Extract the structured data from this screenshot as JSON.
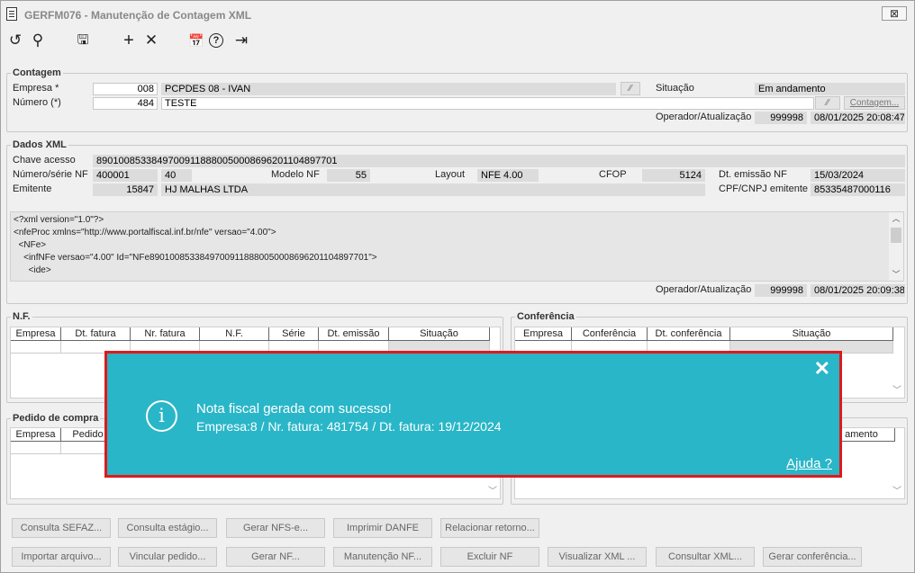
{
  "window": {
    "title": "GERFM076 - Manutenção de Contagem XML",
    "close": "⊠"
  },
  "toolbar": {
    "undo": "↺",
    "search": "⚲",
    "save": "🖫",
    "add": "+",
    "delete": "✕",
    "calendar": "📅",
    "help": "?",
    "exit": "⇥"
  },
  "contagem": {
    "legend": "Contagem",
    "empresa_label": "Empresa *",
    "empresa_code": "008",
    "empresa_name": "PCPDES 08 - IVAN",
    "numero_label": "Número (*)",
    "numero_value": "484",
    "numero_desc": "TESTE",
    "situacao_label": "Situação",
    "situacao_value": "Em andamento",
    "contagem_btn": "Contagem...",
    "operador_label": "Operador/Atualização",
    "operador_value": "999998",
    "operador_date": "08/01/2025 20:08:47"
  },
  "dados_xml": {
    "legend": "Dados XML",
    "chave_label": "Chave acesso",
    "chave_value": "89010085338497009118880050008696201104897701",
    "numero_serie_label": "Número/série NF",
    "numero_value": "400001",
    "serie_value": "40",
    "modelo_label": "Modelo NF",
    "modelo_value": "55",
    "layout_label": "Layout",
    "layout_value": "NFE 4.00",
    "cfop_label": "CFOP",
    "cfop_value": "5124",
    "dt_emissao_label": "Dt. emissão NF",
    "dt_emissao_value": "15/03/2024",
    "emitente_label": "Emitente",
    "emitente_code": "15847",
    "emitente_name": "HJ MALHAS LTDA",
    "cpf_label": "CPF/CNPJ emitente",
    "cpf_value": "85335487000116",
    "xml_lines": [
      "<?xml version=\"1.0\"?>",
      "<nfeProc xmlns=\"http://www.portalfiscal.inf.br/nfe\" versao=\"4.00\">",
      "  <NFe>",
      "    <infNFe versao=\"4.00\" Id=\"NFe89010085338497009118880050008696201104897701\">",
      "      <ide>"
    ],
    "operador_label": "Operador/Atualização",
    "operador_value": "999998",
    "operador_date": "08/01/2025 20:09:38"
  },
  "nf": {
    "legend": "N.F.",
    "columns": [
      "Empresa",
      "Dt. fatura",
      "Nr. fatura",
      "N.F.",
      "Série",
      "Dt. emissão",
      "Situação"
    ]
  },
  "conferencia": {
    "legend": "Conferência",
    "columns": [
      "Empresa",
      "Conferência",
      "Dt. conferência",
      "Situação"
    ]
  },
  "pedido": {
    "legend": "Pedido de compra",
    "columns": [
      "Empresa",
      "Pedido"
    ],
    "right_partial_header": "amento"
  },
  "buttons_row1": [
    "Consulta SEFAZ...",
    "Consulta estágio...",
    "Gerar NFS-e...",
    "Imprimir DANFE",
    "Relacionar retorno..."
  ],
  "buttons_row2": [
    "Importar arquivo...",
    "Vincular pedido...",
    "Gerar NF...",
    "Manutenção NF...",
    "Excluir NF",
    "Visualizar XML ...",
    "Consultar XML...",
    "Gerar conferência..."
  ],
  "toast": {
    "icon": "i",
    "close": "✕",
    "title": "Nota fiscal gerada com sucesso!",
    "message": "Empresa:8 / Nr. fatura: 481754 / Dt. fatura: 19/12/2024",
    "help": "Ajuda ?",
    "border_color": "#e0181b",
    "bg_color": "#29b6c8"
  }
}
